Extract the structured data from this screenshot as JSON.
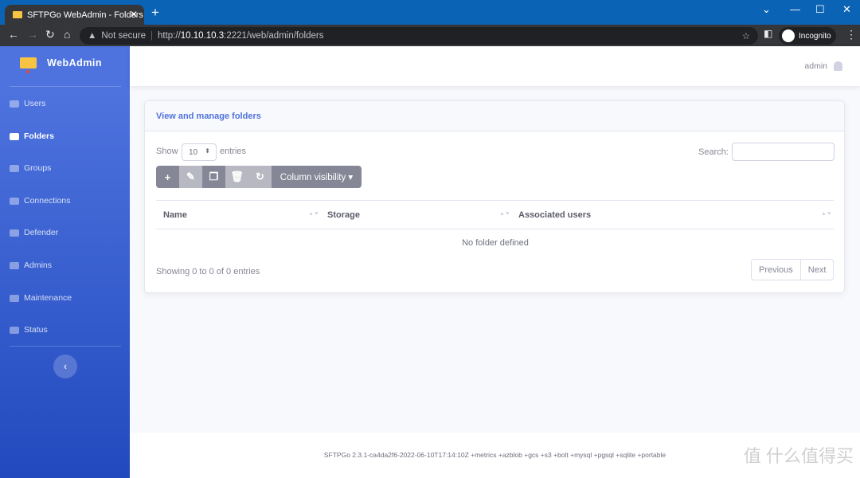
{
  "browser": {
    "tab_title": "SFTPGo WebAdmin - Folders",
    "new_tab": "+",
    "close": "✕",
    "not_secure": "Not secure",
    "url_prefix": "http://",
    "url_host": "10.10.10.3",
    "url_rest": ":2221/web/admin/folders",
    "incognito": "Incognito"
  },
  "sidebar": {
    "brand": "WebAdmin",
    "items": [
      {
        "label": "Users",
        "icon": "users-icon"
      },
      {
        "label": "Folders",
        "icon": "folder-icon",
        "active": true
      },
      {
        "label": "Groups",
        "icon": "groups-icon"
      },
      {
        "label": "Connections",
        "icon": "exchange-icon"
      },
      {
        "label": "Defender",
        "icon": "shield-icon"
      },
      {
        "label": "Admins",
        "icon": "user-cog-icon"
      },
      {
        "label": "Maintenance",
        "icon": "wrench-icon"
      },
      {
        "label": "Status",
        "icon": "info-icon"
      }
    ],
    "toggle": "‹"
  },
  "topbar": {
    "user": "admin"
  },
  "card": {
    "title": "View and manage folders",
    "show": "Show",
    "entries_value": "10",
    "entries": "entries",
    "search_label": "Search:",
    "column_visibility": "Column visibility ▾",
    "columns": [
      "Name",
      "Storage",
      "Associated users"
    ],
    "empty": "No folder defined",
    "info": "Showing 0 to 0 of 0 entries",
    "previous": "Previous",
    "next": "Next"
  },
  "footer": {
    "version": "SFTPGo 2.3.1-ca4da2f6-2022-06-10T17:14:10Z +metrics +azblob +gcs +s3 +bolt +mysql +pgsql +sqlite +portable"
  },
  "watermark": "值 什么值得买",
  "colors": {
    "primary": "#4e73df",
    "sidebar_end": "#224abe",
    "titlebar": "#0b63b5"
  }
}
